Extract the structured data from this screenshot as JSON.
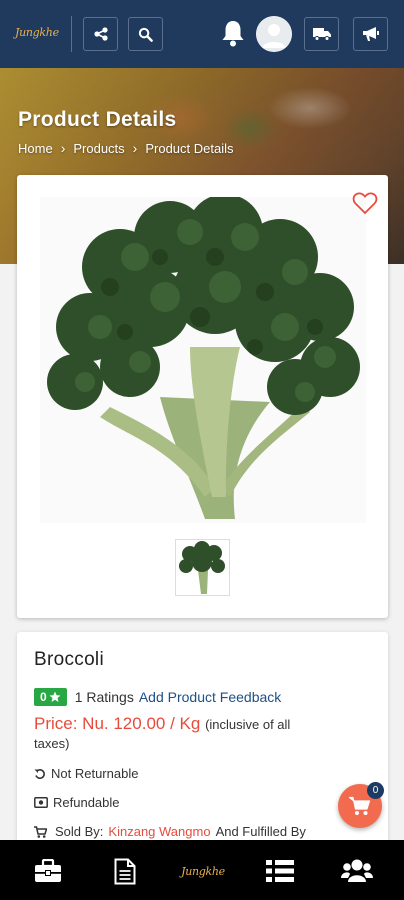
{
  "header": {
    "logo_text": "Jungkhe",
    "icons": [
      "share-nodes-icon",
      "search-icon",
      "bell-icon",
      "avatar",
      "truck-icon",
      "megaphone-icon"
    ]
  },
  "hero": {
    "title": "Product Details",
    "breadcrumb": [
      "Home",
      "Products",
      "Product Details"
    ]
  },
  "product": {
    "name": "Broccoli",
    "rating_value": "0",
    "ratings_text": "1 Ratings",
    "feedback_link": "Add Product Feedback",
    "price": "Price: Nu. 120.00 / Kg",
    "tax_note_1": "(inclusive of all",
    "tax_note_2": "taxes)",
    "returnable": "Not Returnable",
    "refundable": "Refundable",
    "sold_by_label": "Sold By:",
    "seller": "Kinzang Wangmo",
    "fulfilled_by": "And Fulfilled By"
  },
  "cart": {
    "count": "0"
  },
  "bottom_nav": {
    "items": [
      "briefcase-icon",
      "document-icon",
      "home-logo",
      "list-icon",
      "users-icon"
    ],
    "logo_text": "Jungkhe"
  },
  "colors": {
    "header_bg": "#203a5e",
    "price": "#e84b3c",
    "rating_badge": "#28a745",
    "link": "#1e4f87",
    "fab": "#f26b4f"
  }
}
